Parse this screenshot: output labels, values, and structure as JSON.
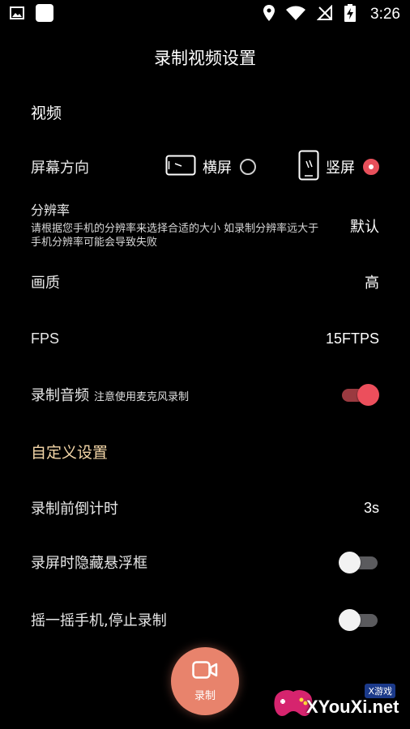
{
  "status_bar": {
    "time": "3:26"
  },
  "title": "录制视频设置",
  "video_section": {
    "header": "视频",
    "orientation": {
      "label": "屏幕方向",
      "landscape": "横屏",
      "portrait": "竖屏",
      "selected": "portrait"
    },
    "resolution": {
      "label": "分辨率",
      "description": "请根据您手机的分辨率来选择合适的大小 如录制分辨率远大于手机分辨率可能会导致失败",
      "value": "默认"
    },
    "quality": {
      "label": "画质",
      "value": "高"
    },
    "fps": {
      "label": "FPS",
      "value": "15FTPS"
    },
    "audio": {
      "label": "录制音频",
      "hint": "注意使用麦克风录制",
      "enabled": true
    }
  },
  "custom_section": {
    "header": "自定义设置",
    "countdown": {
      "label": "录制前倒计时",
      "value": "3s"
    },
    "hide_float": {
      "label": "录屏时隐藏悬浮框",
      "enabled": false
    },
    "shake_stop": {
      "label": "摇一摇手机,停止录制",
      "enabled": false
    }
  },
  "record_button": {
    "label": "录制"
  },
  "watermark": {
    "small": "X游戏",
    "big": "XYouXi.net"
  },
  "colors": {
    "accent": "#ec4f5c",
    "section_header": "#f5d7a8",
    "record_button": "#e8836c"
  }
}
